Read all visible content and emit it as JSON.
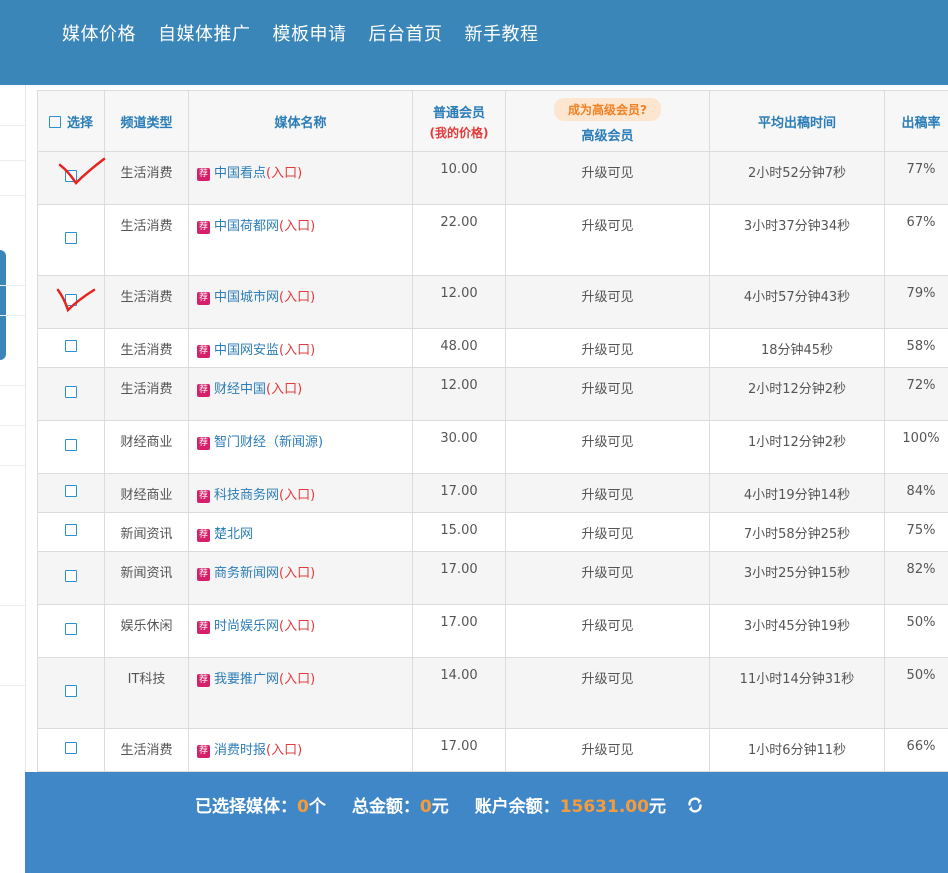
{
  "nav": [
    "媒体价格",
    "自媒体推广",
    "模板申请",
    "后台首页",
    "新手教程"
  ],
  "table": {
    "headers": {
      "select": "选择",
      "channel": "频道类型",
      "media": "媒体名称",
      "normal": "普通会员",
      "normal_sub": "(我的价格)",
      "vip_pill": "成为高级会员?",
      "vip": "高级会员",
      "avg_time": "平均出稿时间",
      "rate": "出稿率"
    },
    "rec_badge": "荐",
    "rows": [
      {
        "channel": "生活消费",
        "media": "中国看点",
        "entry": "(入口)",
        "price": "10.00",
        "vip": "升级可见",
        "time": "2小时52分钟7秒",
        "rate": "77%"
      },
      {
        "channel": "生活消费",
        "media": "中国荷都网",
        "entry": "(入口)",
        "price": "22.00",
        "vip": "升级可见",
        "time": "3小时37分钟34秒",
        "rate": "67%"
      },
      {
        "channel": "生活消费",
        "media": "中国城市网",
        "entry": "(入口)",
        "price": "12.00",
        "vip": "升级可见",
        "time": "4小时57分钟43秒",
        "rate": "79%"
      },
      {
        "channel": "生活消费",
        "media": "中国网安监",
        "entry": "(入口)",
        "price": "48.00",
        "vip": "升级可见",
        "time": "18分钟45秒",
        "rate": "58%"
      },
      {
        "channel": "生活消费",
        "media": "财经中国",
        "entry": "(入口)",
        "price": "12.00",
        "vip": "升级可见",
        "time": "2小时12分钟2秒",
        "rate": "72%"
      },
      {
        "channel": "财经商业",
        "media": "智门财经（新闻源)",
        "entry": "",
        "price": "30.00",
        "vip": "升级可见",
        "time": "1小时12分钟2秒",
        "rate": "100%"
      },
      {
        "channel": "财经商业",
        "media": "科技商务网",
        "entry": "(入口)",
        "price": "17.00",
        "vip": "升级可见",
        "time": "4小时19分钟14秒",
        "rate": "84%"
      },
      {
        "channel": "新闻资讯",
        "media": "楚北网",
        "entry": "",
        "price": "15.00",
        "vip": "升级可见",
        "time": "7小时58分钟25秒",
        "rate": "75%"
      },
      {
        "channel": "新闻资讯",
        "media": "商务新闻网",
        "entry": "(入口)",
        "price": "17.00",
        "vip": "升级可见",
        "time": "3小时25分钟15秒",
        "rate": "82%"
      },
      {
        "channel": "娱乐休闲",
        "media": "时尚娱乐网",
        "entry": "(入口)",
        "price": "17.00",
        "vip": "升级可见",
        "time": "3小时45分钟19秒",
        "rate": "50%"
      },
      {
        "channel": "IT科技",
        "media": "我要推广网",
        "entry": "(入口)",
        "price": "14.00",
        "vip": "升级可见",
        "time": "11小时14分钟31秒",
        "rate": "50%"
      },
      {
        "channel": "生活消费",
        "media": "消费时报",
        "entry": "(入口)",
        "price": "17.00",
        "vip": "升级可见",
        "time": "1小时6分钟11秒",
        "rate": "66%"
      }
    ]
  },
  "footer": {
    "selected_label": "已选择媒体：",
    "selected_count": "0",
    "selected_unit": "个",
    "total_label": "总金额：",
    "total_value": "0",
    "total_unit": "元",
    "balance_label": "账户余额：",
    "balance_value": "15631.00",
    "balance_unit": "元"
  },
  "colors": {
    "header_blue": "#3b86b9",
    "footer_blue": "#3f87c7",
    "accent_orange": "#f79b3a",
    "link_blue": "#2b7db8",
    "entry_red": "#e23b3b",
    "badge_pink": "#d6206a"
  },
  "icons": [
    "refresh-icon",
    "red-check-annotation"
  ]
}
